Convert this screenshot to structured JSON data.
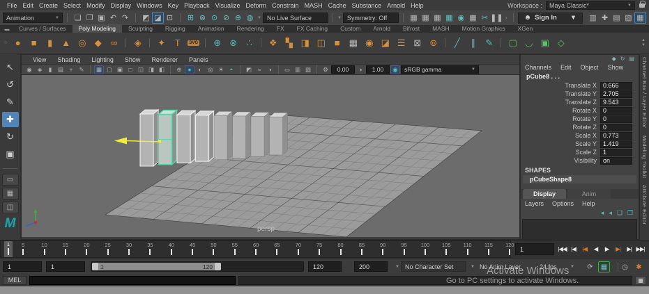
{
  "colors": {
    "accent_orange": "#d78f3c",
    "accent_teal": "#56b8ba",
    "accent_green": "#5fbf6a",
    "selection_green": "#4ed9a4",
    "manipulator_yellow": "#f0ec3a",
    "active_blue": "#5285b5"
  },
  "menu_bar": {
    "items": [
      "File",
      "Edit",
      "Create",
      "Select",
      "Modify",
      "Display",
      "Windows",
      "Key",
      "Playback",
      "Visualize",
      "Deform",
      "Constrain",
      "MASH",
      "Cache",
      "Substance",
      "Arnold",
      "Help"
    ],
    "workspace_label": "Workspace :",
    "workspace_value": "Maya Classic*"
  },
  "toolbar": {
    "mode": "Animation",
    "file_icons": [
      {
        "n": "new-scene-icon",
        "g": "❏"
      },
      {
        "n": "open-scene-icon",
        "g": "❐"
      },
      {
        "n": "save-scene-icon",
        "g": "▣"
      },
      {
        "n": "undo-icon",
        "g": "↶"
      },
      {
        "n": "redo-icon",
        "g": "↷"
      }
    ],
    "select_mode_icons": [
      {
        "n": "select-hierarchy-icon",
        "g": "◩"
      },
      {
        "n": "select-object-icon",
        "g": "◪",
        "active": true
      },
      {
        "n": "select-component-icon",
        "g": "⊡"
      }
    ],
    "snap_icons": [
      {
        "n": "snap-grid-icon",
        "g": "⊞"
      },
      {
        "n": "snap-curve-icon",
        "g": "⊗"
      },
      {
        "n": "snap-point-icon",
        "g": "⊙"
      },
      {
        "n": "snap-projected-center-icon",
        "g": "⊘"
      },
      {
        "n": "snap-view-plane-icon",
        "g": "⊕"
      },
      {
        "n": "make-live-icon",
        "g": "◍"
      }
    ],
    "no_live_surface": "No Live Surface",
    "symmetry": "Symmetry: Off",
    "history_icons": [
      {
        "n": "keyframe-input-icon",
        "g": "▦"
      },
      {
        "n": "keyframe-ops-icon",
        "g": "▦"
      },
      {
        "n": "keyframe-result-icon",
        "g": "▦"
      },
      {
        "n": "construction-history-icon",
        "g": "▦",
        "teal": true
      },
      {
        "n": "playblast-icon",
        "g": "◉",
        "teal": true
      },
      {
        "n": "anim-snapshot-icon",
        "g": "▦"
      },
      {
        "n": "cut-keys-icon",
        "g": "✂",
        "teal": true
      },
      {
        "n": "pause-icon",
        "g": "❚❚"
      }
    ],
    "sign_in": "Sign In",
    "right_icons": [
      {
        "n": "modeling-toolkit-icon",
        "g": "▥"
      },
      {
        "n": "humanik-icon",
        "g": "✚"
      },
      {
        "n": "channel-box-icon",
        "g": "▤"
      },
      {
        "n": "attribute-editor-icon",
        "g": "▧"
      },
      {
        "n": "workspace-panel-icon",
        "g": "▦",
        "active": true
      }
    ]
  },
  "shelf": {
    "tabs": [
      "Curves / Surfaces",
      "Poly Modeling",
      "Sculpting",
      "Rigging",
      "Animation",
      "Rendering",
      "FX",
      "FX Caching",
      "Custom",
      "Arnold",
      "Bifrost",
      "MASH",
      "Motion Graphics",
      "XGen"
    ],
    "active_tab": "Poly Modeling",
    "icons": [
      {
        "n": "poly-sphere-icon",
        "g": "●",
        "c": "#d78f3c"
      },
      {
        "n": "poly-cube-icon",
        "g": "■",
        "c": "#d78f3c"
      },
      {
        "n": "poly-cylinder-icon",
        "g": "▮",
        "c": "#d78f3c"
      },
      {
        "n": "poly-cone-icon",
        "g": "▲",
        "c": "#d78f3c"
      },
      {
        "n": "poly-torus-icon",
        "g": "◎",
        "c": "#d78f3c"
      },
      {
        "n": "poly-plane-icon",
        "g": "◆",
        "c": "#d78f3c"
      },
      {
        "n": "poly-disc-icon",
        "g": "∞",
        "c": "#d78f3c"
      },
      {
        "sep": true
      },
      {
        "n": "platonic-solid-icon",
        "g": "◈",
        "c": "#d78f3c"
      },
      {
        "sep": true
      },
      {
        "n": "super-shape-icon",
        "g": "✦",
        "c": "#d78f3c"
      },
      {
        "n": "type-tool-icon",
        "g": "T",
        "c": "#d78f3c"
      },
      {
        "n": "svg-tool-icon",
        "g": "SVG",
        "c": "#d78f3c",
        "badge": true
      },
      {
        "sep": true
      },
      {
        "n": "construction-plane-icon",
        "g": "⊕",
        "c": "#56b8ba"
      },
      {
        "n": "bake-pivot-icon",
        "g": "⊗",
        "c": "#56b8ba"
      },
      {
        "n": "zero-transforms-icon",
        "g": "∴",
        "c": "#56b8ba"
      },
      {
        "sep": true
      },
      {
        "n": "combine-icon",
        "g": "❖",
        "c": "#d78f3c"
      },
      {
        "n": "separate-icon",
        "g": "▚",
        "c": "#d78f3c"
      },
      {
        "n": "extract-icon",
        "g": "◨",
        "c": "#d78f3c"
      },
      {
        "n": "mirror-icon",
        "g": "◫",
        "c": "#d78f3c"
      },
      {
        "n": "boolean-icon",
        "g": "■",
        "c": "#d78f3c"
      },
      {
        "n": "remesh-icon",
        "g": "▦",
        "c": "#b5b5b5"
      },
      {
        "n": "circularize-icon",
        "g": "◉",
        "c": "#d78f3c"
      },
      {
        "n": "flip-icon",
        "g": "◪",
        "c": "#d78f3c"
      },
      {
        "n": "spread-sheet-icon",
        "g": "☰",
        "c": "#d78f3c"
      },
      {
        "n": "lattice-icon",
        "g": "⊠",
        "c": "#b5b5b5"
      },
      {
        "n": "smooth-mesh-icon",
        "g": "⊚",
        "c": "#d78f3c"
      },
      {
        "sep": true
      },
      {
        "n": "multi-cut-icon",
        "g": "╱",
        "c": "#56b8ba"
      },
      {
        "n": "insert-edge-loop-icon",
        "g": "∥",
        "c": "#56b8ba"
      },
      {
        "n": "offset-edge-loop-icon",
        "g": "✎",
        "c": "#56b8ba"
      },
      {
        "sep": true
      },
      {
        "n": "bevel-icon",
        "g": "▢",
        "c": "#5fbf6a"
      },
      {
        "n": "bridge-icon",
        "g": "◡",
        "c": "#5fbf6a"
      },
      {
        "n": "fill-hole-icon",
        "g": "▣",
        "c": "#5fbf6a"
      },
      {
        "n": "extrude-icon",
        "g": "◇",
        "c": "#5fbf6a"
      }
    ]
  },
  "toolbox": {
    "tools": [
      {
        "n": "select-tool-icon",
        "g": "↖"
      },
      {
        "n": "lasso-select-tool-icon",
        "g": "↺"
      },
      {
        "n": "paint-select-tool-icon",
        "g": "✎"
      },
      {
        "n": "move-tool-icon",
        "g": "✚",
        "active": true
      },
      {
        "n": "rotate-tool-icon",
        "g": "↻"
      },
      {
        "n": "scale-tool-icon",
        "g": "▣"
      }
    ],
    "layouts": [
      {
        "n": "layout-single-pane-icon",
        "g": "▭"
      },
      {
        "n": "layout-four-pane-icon",
        "g": "▦"
      },
      {
        "n": "layout-two-pane-icon",
        "g": "◫"
      }
    ],
    "logo": "M"
  },
  "viewport": {
    "menu": [
      "View",
      "Shading",
      "Lighting",
      "Show",
      "Renderer",
      "Panels"
    ],
    "icons": [
      {
        "n": "camera-icon",
        "g": "◉"
      },
      {
        "n": "camera-attributes-icon",
        "g": "◈"
      },
      {
        "n": "bookmark-icon",
        "g": "▮"
      },
      {
        "n": "image-plane-icon",
        "g": "▤"
      },
      {
        "n": "2d-pan-zoom-icon",
        "g": "+"
      },
      {
        "n": "grease-pencil-icon",
        "g": "✎"
      },
      {
        "sep": true
      },
      {
        "n": "wireframe-mode-icon",
        "g": "▦",
        "pressed": true
      },
      {
        "n": "shaded-mode-icon",
        "g": "▢"
      },
      {
        "n": "textured-mode-icon",
        "g": "▣"
      },
      {
        "n": "default-material-icon",
        "g": "□"
      },
      {
        "n": "xray-icon",
        "g": "◫"
      },
      {
        "n": "xray-joints-icon",
        "g": "◨"
      },
      {
        "n": "isolate-icon",
        "g": "◧"
      },
      {
        "sep": true
      },
      {
        "n": "all-lights-icon",
        "g": "⊕"
      },
      {
        "n": "shaded-sphere-icon",
        "g": "●",
        "teal": true,
        "pressed": true
      },
      {
        "n": "flat-lighting-icon",
        "g": "◐"
      },
      {
        "n": "textured-sphere-icon",
        "g": "◎"
      },
      {
        "n": "shadows-icon",
        "g": "☀"
      },
      {
        "n": "ssao-icon",
        "g": "◓",
        "teal": true
      },
      {
        "sep": true
      },
      {
        "n": "isolate-select-icon",
        "g": "◩"
      },
      {
        "n": "fog-icon",
        "g": "≈"
      },
      {
        "n": "dof-icon",
        "g": "◑"
      },
      {
        "sep": true
      },
      {
        "n": "pane-layout-icon",
        "g": "▭"
      },
      {
        "n": "film-gate-icon",
        "g": "▥"
      },
      {
        "n": "resolution-gate-icon",
        "g": "▧"
      },
      {
        "sep": true
      },
      {
        "n": "exposure-gear-icon",
        "g": "⚙"
      }
    ],
    "exposure": "0.00",
    "gamma": "1.00",
    "gamma_icon": "◑",
    "colorspace_icon": "◉",
    "color_space": "sRGB gamma",
    "camera_label": "persp"
  },
  "channel_box": {
    "corner_icons": [
      {
        "n": "channel-manip-icon",
        "g": "◆"
      },
      {
        "n": "channel-speed-icon",
        "g": "↻"
      },
      {
        "n": "channel-options-icon",
        "g": "▤"
      }
    ],
    "menu": [
      "Channels",
      "Edit",
      "Object",
      "Show"
    ],
    "object_name": "pCube8 . . .",
    "attributes": [
      {
        "label": "Translate X",
        "value": "0.666"
      },
      {
        "label": "Translate Y",
        "value": "2.705"
      },
      {
        "label": "Translate Z",
        "value": "9.543"
      },
      {
        "label": "Rotate X",
        "value": "0"
      },
      {
        "label": "Rotate Y",
        "value": "0"
      },
      {
        "label": "Rotate Z",
        "value": "0"
      },
      {
        "label": "Scale X",
        "value": "0.773"
      },
      {
        "label": "Scale Y",
        "value": "1.419"
      },
      {
        "label": "Scale Z",
        "value": "1"
      },
      {
        "label": "Visibility",
        "value": "on"
      }
    ],
    "shapes_label": "SHAPES",
    "shape_name": "pCubeShape8"
  },
  "layer_editor": {
    "tabs": [
      "Display",
      "Anim"
    ],
    "active_tab": "Display",
    "menu": [
      "Layers",
      "Options",
      "Help"
    ],
    "icons": [
      {
        "n": "layer-move-up-icon",
        "g": "◂"
      },
      {
        "n": "layer-move-down-icon",
        "g": "◂"
      },
      {
        "n": "new-layer-icon",
        "g": "❏"
      },
      {
        "n": "new-layer-from-selected-icon",
        "g": "❐"
      }
    ]
  },
  "side_tabs": [
    {
      "name": "sidebar-tab-channel-box",
      "label": "Channel Box / Layer Editor"
    },
    {
      "name": "sidebar-tab-modeling-toolkit",
      "label": "Modeling Toolkit"
    },
    {
      "name": "sidebar-tab-attribute-editor",
      "label": "Attribute Editor"
    }
  ],
  "timeline": {
    "tick_start": 5,
    "tick_end": 120,
    "tick_step": 5,
    "current_frame": "1",
    "frame_field": "1"
  },
  "playback": {
    "buttons": [
      {
        "name": "go-to-start-button",
        "glyph": "|◀◀"
      },
      {
        "name": "step-back-frame-button",
        "glyph": "|◀"
      },
      {
        "name": "step-back-key-button",
        "glyph": "|◀",
        "accent": true
      },
      {
        "name": "play-backwards-button",
        "glyph": "◀"
      },
      {
        "name": "play-forwards-button",
        "glyph": "▶"
      },
      {
        "name": "step-forward-key-button",
        "glyph": "▶|",
        "accent": true
      },
      {
        "name": "step-forward-frame-button",
        "glyph": "▶|"
      },
      {
        "name": "go-to-end-button",
        "glyph": "▶▶|"
      }
    ]
  },
  "range_slider": {
    "anim_start": "1",
    "playback_start": "1",
    "bar_start_label": "1",
    "bar_end_label": "120",
    "playback_end": "120",
    "anim_end": "200",
    "character_set": "No Character Set",
    "anim_layer": "No Anim Layer",
    "fps": "24 fps"
  },
  "command_line": {
    "label": "MEL",
    "input_value": "",
    "result_value": ""
  },
  "watermark": {
    "line1": "Activate Windows",
    "line2": "Go to PC settings to activate Windows."
  }
}
